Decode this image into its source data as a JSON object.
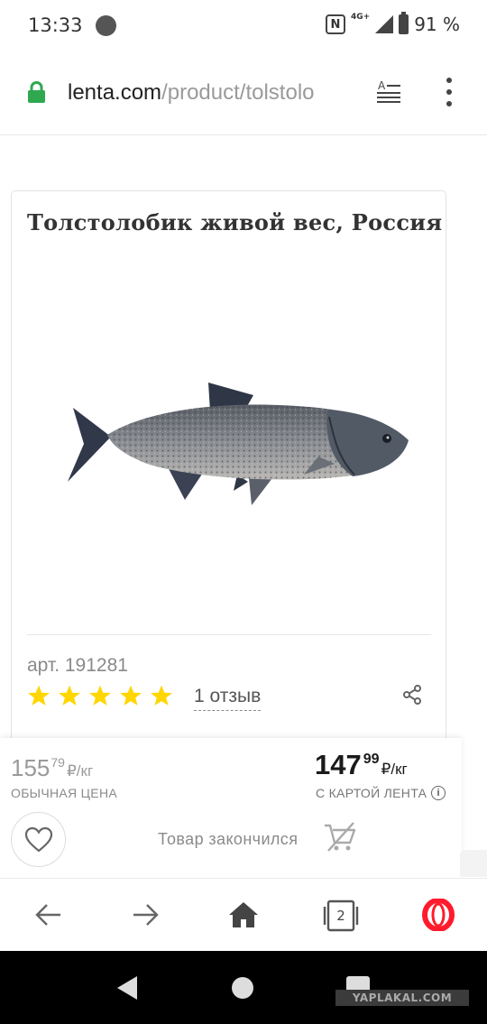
{
  "status_bar": {
    "time": "13:33",
    "network": "4G+",
    "nfc": "N",
    "battery": "91 %"
  },
  "browser": {
    "url_host": "lenta.com",
    "url_path": "/product/tolstolo",
    "icons": [
      "lock-icon",
      "reader-mode-icon",
      "more-vert-icon"
    ]
  },
  "product": {
    "title": "Толстолобик живой вес, Россия",
    "article": "арт. 191281",
    "rating": 5,
    "rating_max": 5,
    "reviews": "1 отзыв"
  },
  "price": {
    "regular_main": "155",
    "regular_cents": "79",
    "regular_unit": "₽/кг",
    "regular_label": "ОБЫЧНАЯ ЦЕНА",
    "card_main": "147",
    "card_cents": "99",
    "card_unit": "₽/кг",
    "card_label": "С КАРТОЙ ЛЕНТА",
    "stock_status": "Товар закончился"
  },
  "bottom_bar": {
    "tabs_count": "2",
    "icons": [
      "back-arrow-icon",
      "forward-arrow-icon",
      "home-icon",
      "tabs-icon",
      "opera-icon"
    ]
  },
  "watermark": "YAPLAKAL.COM",
  "colors": {
    "star": "#ffd600",
    "lock": "#2fa84f",
    "opera": "#ff1b2d"
  }
}
